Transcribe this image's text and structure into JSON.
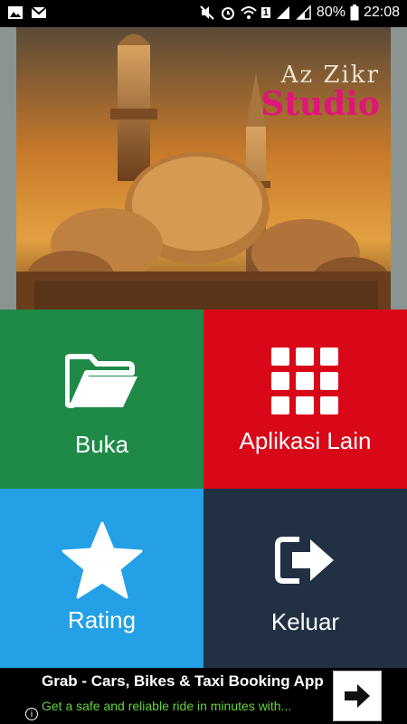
{
  "status_bar": {
    "battery": "80%",
    "time": "22:08",
    "sim_badge": "1"
  },
  "banner": {
    "logo_top": "Az Zikr",
    "logo_bottom": "Studio",
    "logo_color": "#e0147a"
  },
  "menu": {
    "open_label": "Buka",
    "other_apps_label": "Aplikasi Lain",
    "rating_label": "Rating",
    "exit_label": "Keluar"
  },
  "ad": {
    "title": "Grab - Cars, Bikes & Taxi Booking App",
    "subtitle": "Get a safe and reliable ride in minutes with...",
    "info_glyph": "i"
  }
}
